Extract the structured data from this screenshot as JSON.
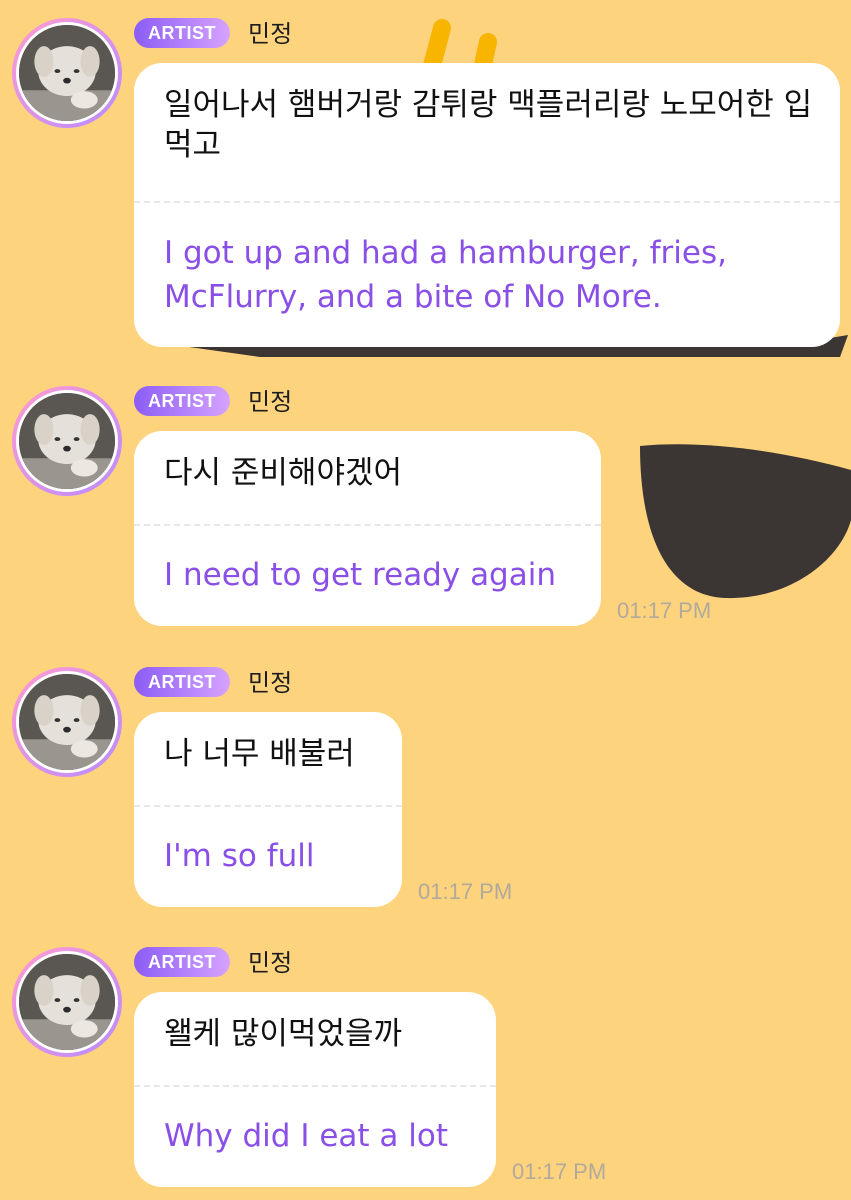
{
  "messages": [
    {
      "badge": "ARTIST",
      "sender": "민정",
      "korean": "일어나서 햄버거랑 감튀랑 맥플러리랑 노모어한 입먹고",
      "english": "I got up and had a hamburger, fries, McFlurry, and a bite of No More.",
      "time": ""
    },
    {
      "badge": "ARTIST",
      "sender": "민정",
      "korean": "다시 준비해야겠어",
      "english": "I need to get ready again",
      "time": "01:17 PM"
    },
    {
      "badge": "ARTIST",
      "sender": "민정",
      "korean": "나 너무 배불러",
      "english": "I'm so full",
      "time": "01:17 PM"
    },
    {
      "badge": "ARTIST",
      "sender": "민정",
      "korean": "왤케 많이먹었을까",
      "english": "Why did I eat a lot",
      "time": "01:17 PM"
    }
  ],
  "colors": {
    "background": "#fdd37e",
    "translation_text": "#8a4fe6",
    "badge_gradient": [
      "#8b5cf6",
      "#d6a3ff"
    ],
    "decoration": "#3b3534",
    "decoration_accent": "#f7b500"
  },
  "icons": [
    "avatar-dog-photo",
    "sunglasses-decoration"
  ]
}
